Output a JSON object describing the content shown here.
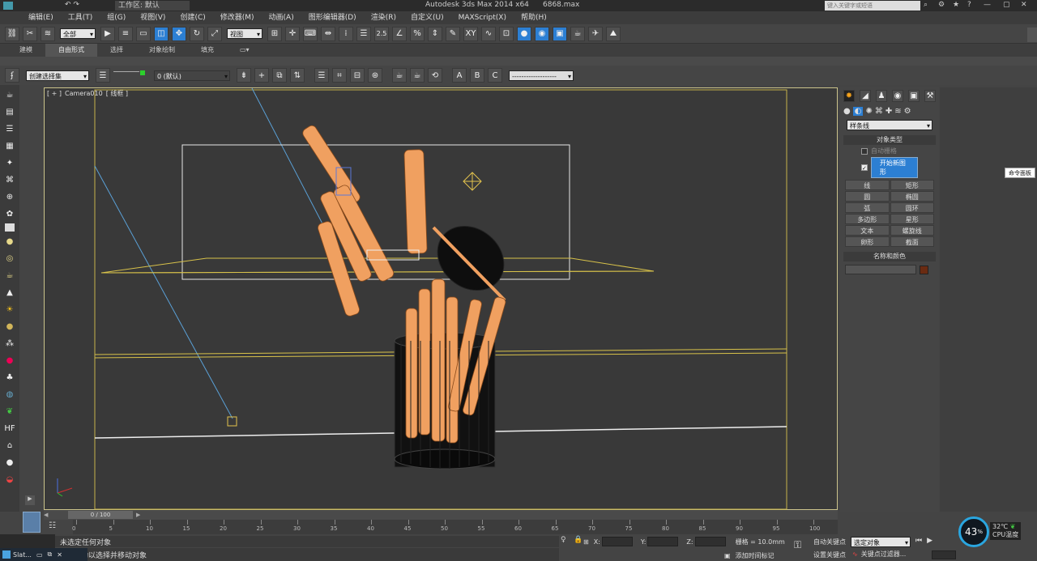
{
  "titlebar": {
    "workspace_label": "工作区: 默认",
    "app_title": "Autodesk 3ds Max  2014 x64",
    "file_name": "6868.max",
    "search_placeholder": "键入关键字或短语"
  },
  "menu": [
    "编辑(E)",
    "工具(T)",
    "组(G)",
    "视图(V)",
    "创建(C)",
    "修改器(M)",
    "动画(A)",
    "图形编辑器(D)",
    "渲染(R)",
    "自定义(U)",
    "MAXScript(X)",
    "帮助(H)"
  ],
  "toolbar1": {
    "selection_filter": "全部",
    "coord_system": "视图",
    "snap_angle": "2.5",
    "snap_percent": "%"
  },
  "ribbon_tabs": [
    "建模",
    "自由形式",
    "选择",
    "对象绘制",
    "填充"
  ],
  "active_ribbon_tab": "自由形式",
  "toolbar3": {
    "named_selection": "创建选择集",
    "layer": "0 (默认)"
  },
  "viewport": {
    "label_prefix": "[ + ]",
    "camera": "Camera010",
    "mode": "[ 线框 ]"
  },
  "right_panel": {
    "dropdown": "样条线",
    "rollout_object_type": "对象类型",
    "auto_grid": "自动栅格",
    "start_new_shape": "开始新图形",
    "buttons": [
      "线",
      "矩形",
      "圆",
      "椭圆",
      "弧",
      "圆环",
      "多边形",
      "星形",
      "文本",
      "螺旋线",
      "卵形",
      "截面"
    ],
    "rollout_name_color": "名称和颜色",
    "object_color": "#6a2b12"
  },
  "tooltip_cmd": "命令面板",
  "timeline": {
    "frame": "0 / 100",
    "ticks": [
      "0",
      "5",
      "10",
      "15",
      "20",
      "25",
      "30",
      "35",
      "40",
      "45",
      "50",
      "55",
      "60",
      "65",
      "70",
      "75",
      "80",
      "85",
      "90",
      "95",
      "100"
    ]
  },
  "status": {
    "line1": "未选定任何对象",
    "line2": "动以选择并移动对象",
    "x_label": "X:",
    "y_label": "Y:",
    "z_label": "Z:",
    "grid": "栅格 = 10.0mm",
    "add_time_tag": "添加时间标记",
    "auto_key": "自动关键点",
    "set_key": "设置关键点",
    "key_mode_select": "选定对象",
    "key_filter": "关键点过滤器..."
  },
  "cpu": {
    "percent": "43",
    "unit": "%",
    "temp": "32℃",
    "temp_label": "CPU温度"
  },
  "taskbar": {
    "item": "Slat..."
  },
  "colors": {
    "wire_orange": "#f0a060",
    "yellow": "#d8c24a",
    "blue_line": "#5aa0d6"
  }
}
